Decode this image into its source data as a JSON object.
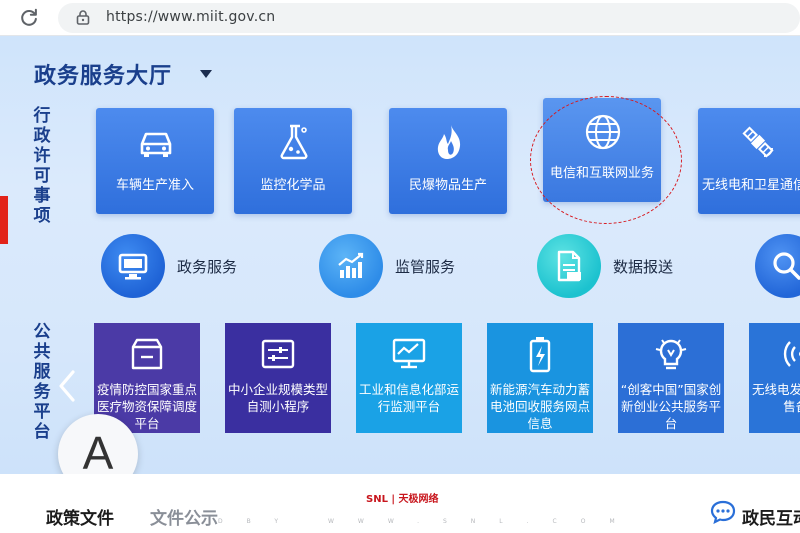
{
  "browser": {
    "url": "https://www.miit.gov.cn"
  },
  "hall": {
    "title": "政务服务大厅"
  },
  "admin_label": "行政许可事项",
  "public_label": "公共服务平台",
  "license_items": [
    {
      "label": "车辆生产准入",
      "icon": "car-icon"
    },
    {
      "label": "监控化学品",
      "icon": "flask-icon"
    },
    {
      "label": "民爆物品生产",
      "icon": "flame-icon"
    },
    {
      "label": "电信和互联网业务",
      "icon": "globe-icon"
    },
    {
      "label": "无线电和卫星通信",
      "icon": "satellite-icon"
    }
  ],
  "services": [
    {
      "label": "政务服务",
      "icon": "monitor-icon"
    },
    {
      "label": "监管服务",
      "icon": "bar-chart-icon"
    },
    {
      "label": "数据报送",
      "icon": "document-icon"
    },
    {
      "label": "",
      "icon": "search-icon"
    }
  ],
  "platforms": [
    {
      "label": "疫情防控国家重点医疗物资保障调度平台",
      "icon": "box-icon",
      "color": "#4b3aa6"
    },
    {
      "label": "中小企业规模类型自测小程序",
      "icon": "sliders-icon",
      "color": "#3a2fa0"
    },
    {
      "label": "工业和信息化部运行监测平台",
      "icon": "monitor-chart-icon",
      "color": "#1aa2e6"
    },
    {
      "label": "新能源汽车动力蓄电池回收服务网点信息",
      "icon": "battery-icon",
      "color": "#1a94e0"
    },
    {
      "label": "“创客中国”国家创新创业公共服务平台",
      "icon": "bulb-icon",
      "color": "#2c6fd6"
    },
    {
      "label": "无线电发射设备销售备案",
      "icon": "signal-icon",
      "color": "#2a74d8"
    }
  ],
  "accessibility_letter": "A",
  "bottom": {
    "tab1": "政策文件",
    "tab2": "文件公示",
    "tab3": "政民互动"
  },
  "watermark": {
    "brand": "SNL | 天极网络",
    "sub": "DBY WWW.SNL.COM"
  },
  "colors": {
    "accent": "#2f6fdc",
    "highlight_circle": "#d7191f",
    "marker": "#e2231a"
  }
}
